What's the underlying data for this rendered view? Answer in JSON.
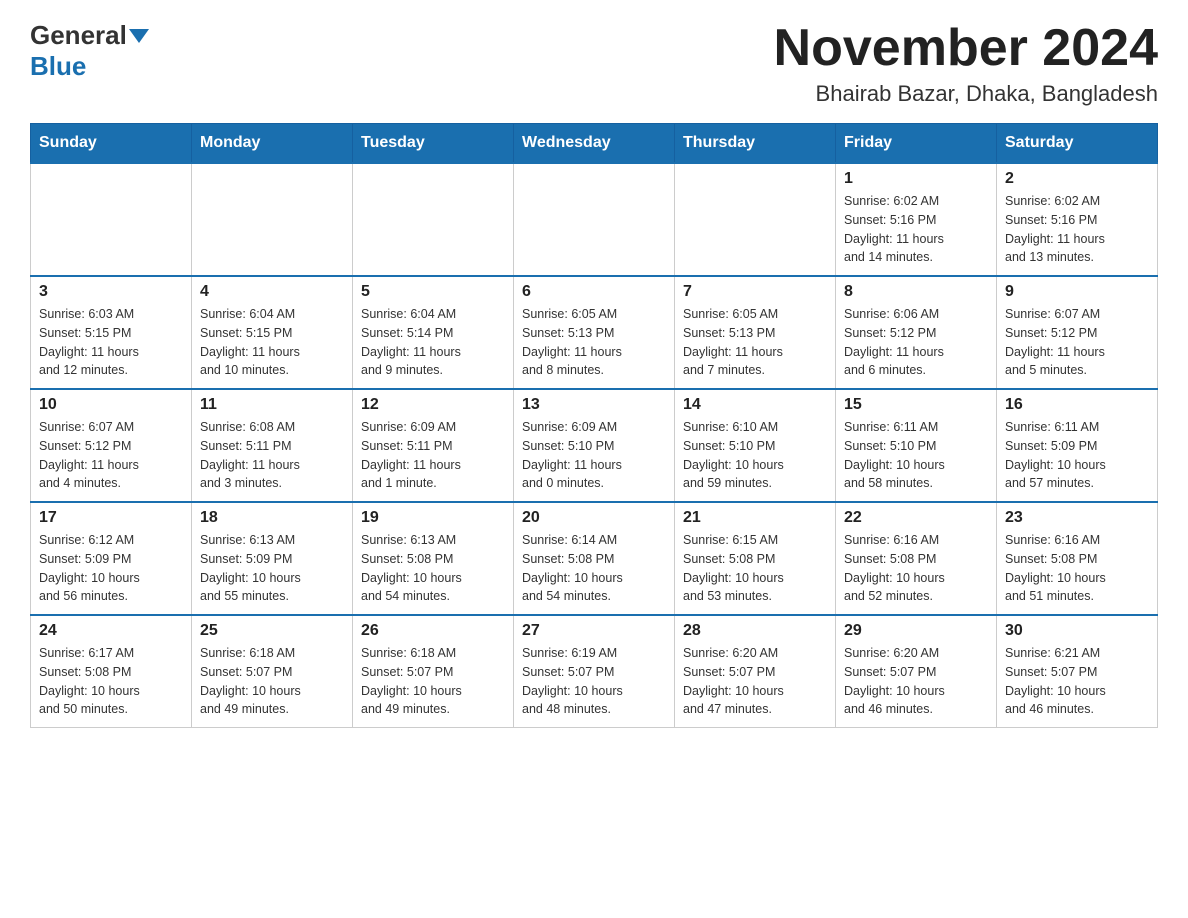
{
  "header": {
    "logo_general": "General",
    "logo_blue": "Blue",
    "month_title": "November 2024",
    "location": "Bhairab Bazar, Dhaka, Bangladesh"
  },
  "days_of_week": [
    "Sunday",
    "Monday",
    "Tuesday",
    "Wednesday",
    "Thursday",
    "Friday",
    "Saturday"
  ],
  "weeks": [
    {
      "days": [
        {
          "num": "",
          "info": ""
        },
        {
          "num": "",
          "info": ""
        },
        {
          "num": "",
          "info": ""
        },
        {
          "num": "",
          "info": ""
        },
        {
          "num": "",
          "info": ""
        },
        {
          "num": "1",
          "info": "Sunrise: 6:02 AM\nSunset: 5:16 PM\nDaylight: 11 hours\nand 14 minutes."
        },
        {
          "num": "2",
          "info": "Sunrise: 6:02 AM\nSunset: 5:16 PM\nDaylight: 11 hours\nand 13 minutes."
        }
      ]
    },
    {
      "days": [
        {
          "num": "3",
          "info": "Sunrise: 6:03 AM\nSunset: 5:15 PM\nDaylight: 11 hours\nand 12 minutes."
        },
        {
          "num": "4",
          "info": "Sunrise: 6:04 AM\nSunset: 5:15 PM\nDaylight: 11 hours\nand 10 minutes."
        },
        {
          "num": "5",
          "info": "Sunrise: 6:04 AM\nSunset: 5:14 PM\nDaylight: 11 hours\nand 9 minutes."
        },
        {
          "num": "6",
          "info": "Sunrise: 6:05 AM\nSunset: 5:13 PM\nDaylight: 11 hours\nand 8 minutes."
        },
        {
          "num": "7",
          "info": "Sunrise: 6:05 AM\nSunset: 5:13 PM\nDaylight: 11 hours\nand 7 minutes."
        },
        {
          "num": "8",
          "info": "Sunrise: 6:06 AM\nSunset: 5:12 PM\nDaylight: 11 hours\nand 6 minutes."
        },
        {
          "num": "9",
          "info": "Sunrise: 6:07 AM\nSunset: 5:12 PM\nDaylight: 11 hours\nand 5 minutes."
        }
      ]
    },
    {
      "days": [
        {
          "num": "10",
          "info": "Sunrise: 6:07 AM\nSunset: 5:12 PM\nDaylight: 11 hours\nand 4 minutes."
        },
        {
          "num": "11",
          "info": "Sunrise: 6:08 AM\nSunset: 5:11 PM\nDaylight: 11 hours\nand 3 minutes."
        },
        {
          "num": "12",
          "info": "Sunrise: 6:09 AM\nSunset: 5:11 PM\nDaylight: 11 hours\nand 1 minute."
        },
        {
          "num": "13",
          "info": "Sunrise: 6:09 AM\nSunset: 5:10 PM\nDaylight: 11 hours\nand 0 minutes."
        },
        {
          "num": "14",
          "info": "Sunrise: 6:10 AM\nSunset: 5:10 PM\nDaylight: 10 hours\nand 59 minutes."
        },
        {
          "num": "15",
          "info": "Sunrise: 6:11 AM\nSunset: 5:10 PM\nDaylight: 10 hours\nand 58 minutes."
        },
        {
          "num": "16",
          "info": "Sunrise: 6:11 AM\nSunset: 5:09 PM\nDaylight: 10 hours\nand 57 minutes."
        }
      ]
    },
    {
      "days": [
        {
          "num": "17",
          "info": "Sunrise: 6:12 AM\nSunset: 5:09 PM\nDaylight: 10 hours\nand 56 minutes."
        },
        {
          "num": "18",
          "info": "Sunrise: 6:13 AM\nSunset: 5:09 PM\nDaylight: 10 hours\nand 55 minutes."
        },
        {
          "num": "19",
          "info": "Sunrise: 6:13 AM\nSunset: 5:08 PM\nDaylight: 10 hours\nand 54 minutes."
        },
        {
          "num": "20",
          "info": "Sunrise: 6:14 AM\nSunset: 5:08 PM\nDaylight: 10 hours\nand 54 minutes."
        },
        {
          "num": "21",
          "info": "Sunrise: 6:15 AM\nSunset: 5:08 PM\nDaylight: 10 hours\nand 53 minutes."
        },
        {
          "num": "22",
          "info": "Sunrise: 6:16 AM\nSunset: 5:08 PM\nDaylight: 10 hours\nand 52 minutes."
        },
        {
          "num": "23",
          "info": "Sunrise: 6:16 AM\nSunset: 5:08 PM\nDaylight: 10 hours\nand 51 minutes."
        }
      ]
    },
    {
      "days": [
        {
          "num": "24",
          "info": "Sunrise: 6:17 AM\nSunset: 5:08 PM\nDaylight: 10 hours\nand 50 minutes."
        },
        {
          "num": "25",
          "info": "Sunrise: 6:18 AM\nSunset: 5:07 PM\nDaylight: 10 hours\nand 49 minutes."
        },
        {
          "num": "26",
          "info": "Sunrise: 6:18 AM\nSunset: 5:07 PM\nDaylight: 10 hours\nand 49 minutes."
        },
        {
          "num": "27",
          "info": "Sunrise: 6:19 AM\nSunset: 5:07 PM\nDaylight: 10 hours\nand 48 minutes."
        },
        {
          "num": "28",
          "info": "Sunrise: 6:20 AM\nSunset: 5:07 PM\nDaylight: 10 hours\nand 47 minutes."
        },
        {
          "num": "29",
          "info": "Sunrise: 6:20 AM\nSunset: 5:07 PM\nDaylight: 10 hours\nand 46 minutes."
        },
        {
          "num": "30",
          "info": "Sunrise: 6:21 AM\nSunset: 5:07 PM\nDaylight: 10 hours\nand 46 minutes."
        }
      ]
    }
  ]
}
